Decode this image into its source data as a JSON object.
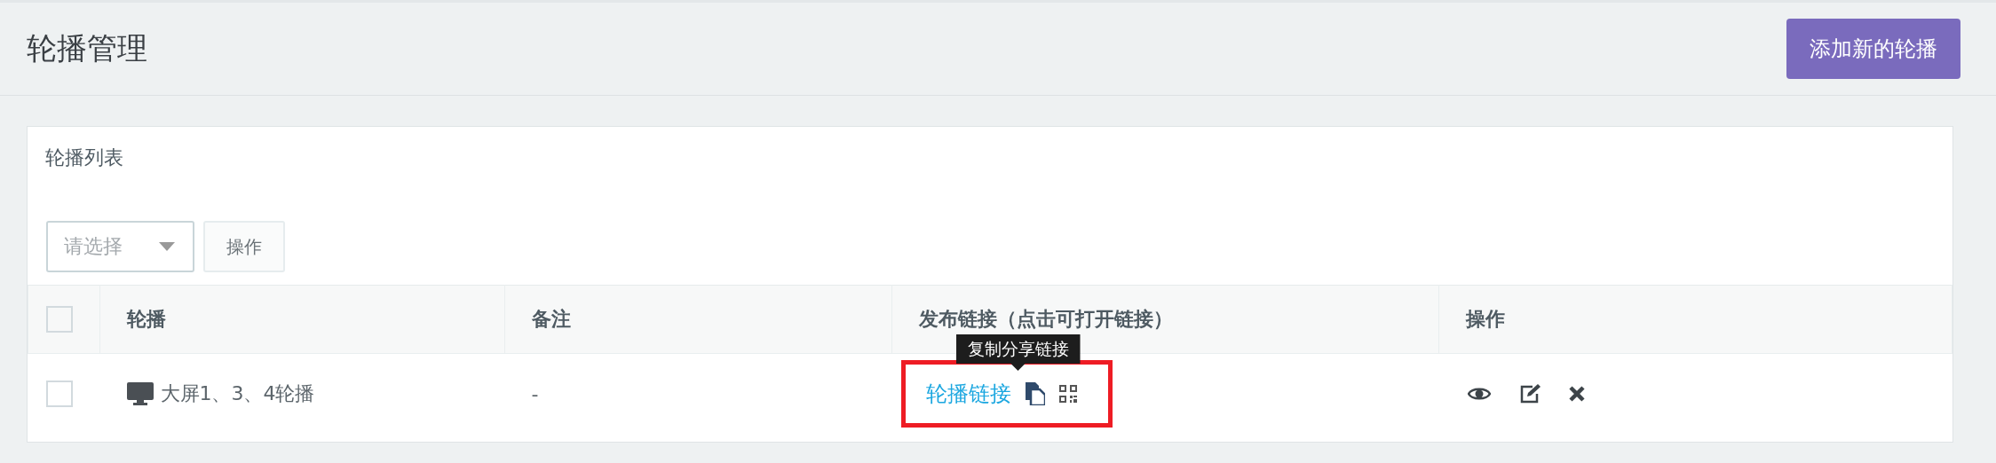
{
  "page": {
    "title": "轮播管理",
    "add_button": "添加新的轮播"
  },
  "panel": {
    "title": "轮播列表",
    "bulk_select": {
      "placeholder": "请选择"
    },
    "bulk_button": "操作"
  },
  "table": {
    "header_checked": false,
    "columns": [
      "轮播",
      "备注",
      "发布链接（点击可打开链接）",
      "操作"
    ],
    "rows": [
      {
        "checked": false,
        "name": "大屏1、3、4轮播",
        "note": "-",
        "link": "轮播链接",
        "highlighted": true
      }
    ]
  },
  "tooltip": {
    "text": "复制分享链接"
  }
}
